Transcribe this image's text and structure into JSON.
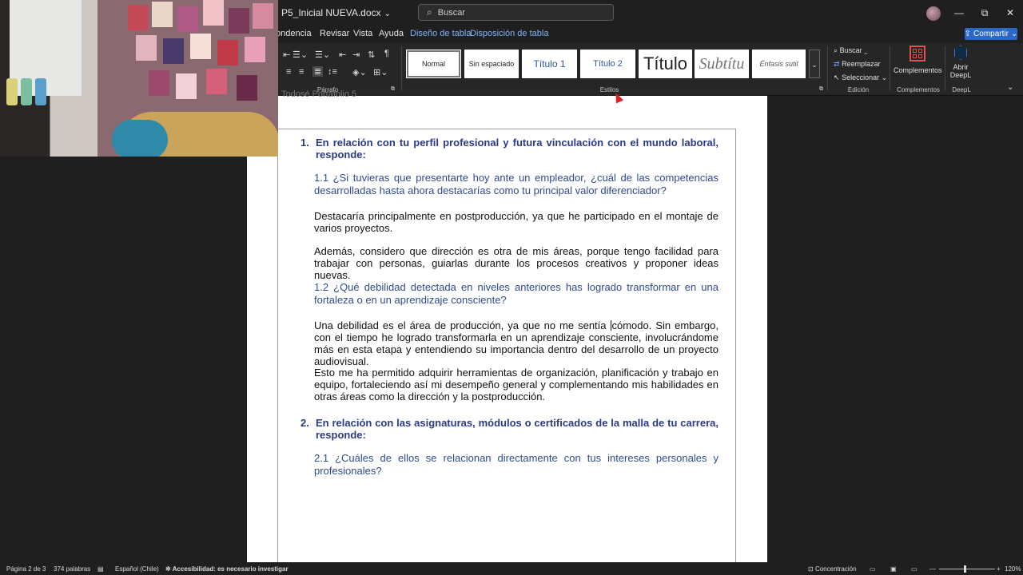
{
  "titlebar": {
    "doc_name": "P5_Inicial NUEVA.docx",
    "search_placeholder": "Buscar",
    "minimize": "—",
    "restore": "⧉",
    "close": "✕"
  },
  "tabs": [
    {
      "label": "ondencia"
    },
    {
      "label": "Revisar"
    },
    {
      "label": "Vista"
    },
    {
      "label": "Ayuda"
    },
    {
      "label": "Diseño de tabla"
    },
    {
      "label": "Disposición de tabla"
    }
  ],
  "share_label": "Compartir",
  "ribbon": {
    "paragraph_label": "Párrafo",
    "styles_label": "Estilos",
    "editing_label": "Edición",
    "addins_label": "Complementos",
    "deepl_label": "DeepL",
    "styles": [
      {
        "name": "Normal"
      },
      {
        "name": "Sin espaciado"
      },
      {
        "name": "Título 1"
      },
      {
        "name": "Título 2"
      },
      {
        "name": "Título"
      },
      {
        "name": "Subtítu"
      },
      {
        "name": "Énfasis sutil"
      }
    ],
    "find_label": "Buscar",
    "replace_label": "Reemplazar",
    "select_label": "Seleccionar",
    "addins_btn": "Complementos",
    "deepl_btn_line1": "Abrir",
    "deepl_btn_line2": "DeepL"
  },
  "document": {
    "prev_footer": "Todosé Portafolio 5",
    "q1_num": "1.",
    "q1_text": "En relación con tu perfil profesional y futura vinculación con el mundo laboral, responde:",
    "q1_1": "1.1 ¿Si tuvieras que presentarte hoy ante un empleador, ¿cuál de las competencias desarrolladas hasta ahora destacarías como tu principal valor diferenciador?",
    "a1_1_p1": "Destacaría principalmente en postproducción, ya que he participado en el montaje de varios proyectos.",
    "a1_1_p2": "Además, considero que dirección es otra de mis áreas, porque tengo facilidad para trabajar con personas, guiarlas durante los procesos creativos y proponer ideas nuevas.",
    "q1_2": "1.2 ¿Qué debilidad detectada en niveles anteriores has logrado transformar en una fortaleza o en un aprendizaje consciente?",
    "a1_2_p1_before": "Una debilidad es el área de producción, ya que no me sentía ",
    "a1_2_p1_after": "cómodo. Sin embargo, con el tiempo he logrado transformarla en un aprendizaje consciente, involucrándome más en esta etapa y entendiendo su importancia dentro del desarrollo de un proyecto audiovisual.",
    "a1_2_p2": "Esto me ha permitido adquirir herramientas de organización, planificación y trabajo en equipo, fortaleciendo así mi desempeño general y complementando mis habilidades en otras áreas como la dirección y la postproducción.",
    "q2_num": "2.",
    "q2_text": "En relación con las asignaturas, módulos o certificados de la malla de tu carrera, responde:",
    "q2_1": "2.1 ¿Cuáles de ellos se relacionan directamente con tus intereses personales y profesionales?"
  },
  "status": {
    "page": "Página 2 de 3",
    "words": "374 palabras",
    "language": "Español (Chile)",
    "accessibility": "Accesibilidad: es necesario investigar",
    "focus": "Concentración",
    "zoom": "120%"
  },
  "colors": {
    "heading_blue": "#2b3a84",
    "subquestion_blue": "#2f4b8f",
    "share_blue": "#2b67c4",
    "context_tab_blue": "#7fb2ff"
  }
}
